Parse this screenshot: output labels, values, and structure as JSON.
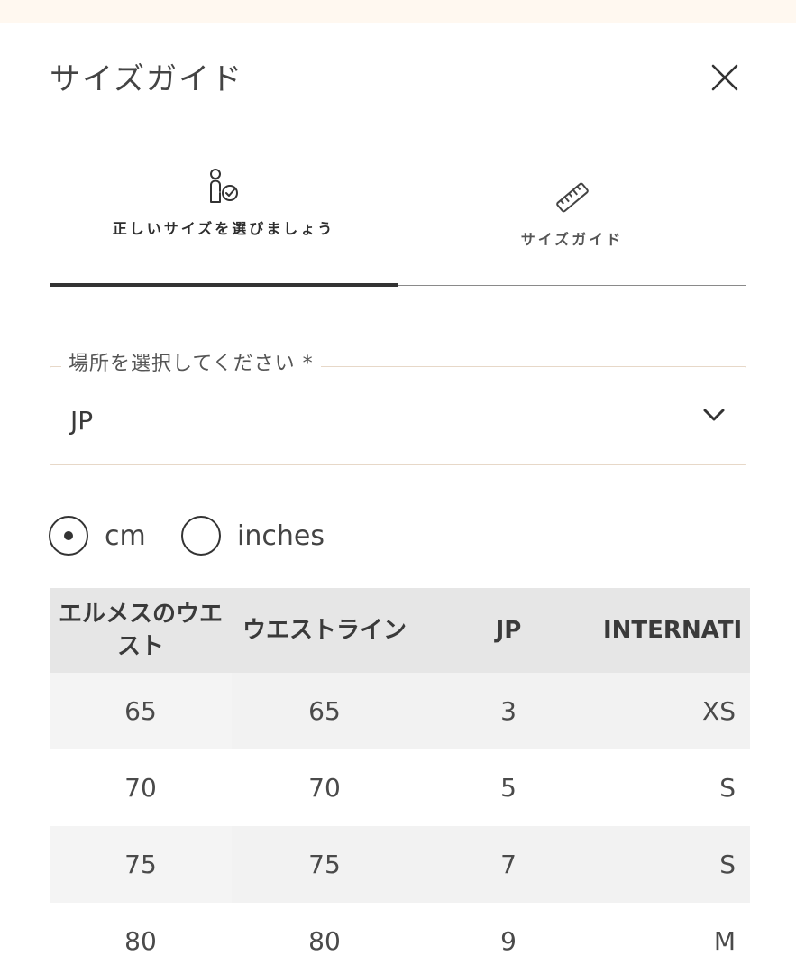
{
  "modal": {
    "title": "サイズガイド",
    "close_icon": "close-icon"
  },
  "tabs": [
    {
      "label": "正しいサイズを選びましょう",
      "icon": "person-check-icon",
      "active": true
    },
    {
      "label": "サイズガイド",
      "icon": "ruler-icon",
      "active": false
    }
  ],
  "location_select": {
    "legend": "場所を選択してください *",
    "value": "JP",
    "icon": "chevron-down-icon"
  },
  "units": {
    "options": [
      {
        "label": "cm",
        "selected": true
      },
      {
        "label": "inches",
        "selected": false
      }
    ]
  },
  "size_table": {
    "headers": [
      "エルメスのウエスト",
      "ウエストライン",
      "JP",
      "INTERNATI"
    ],
    "rows": [
      [
        "65",
        "65",
        "3",
        "XS"
      ],
      [
        "70",
        "70",
        "5",
        "S"
      ],
      [
        "75",
        "75",
        "7",
        "S"
      ],
      [
        "80",
        "80",
        "9",
        "M"
      ]
    ]
  },
  "colors": {
    "top_band": "#fff8f0",
    "header_bg": "#e6e6e6",
    "row_shade": "#f2f2f2",
    "select_border": "#e7d8c8",
    "text": "#3a3a3a"
  }
}
